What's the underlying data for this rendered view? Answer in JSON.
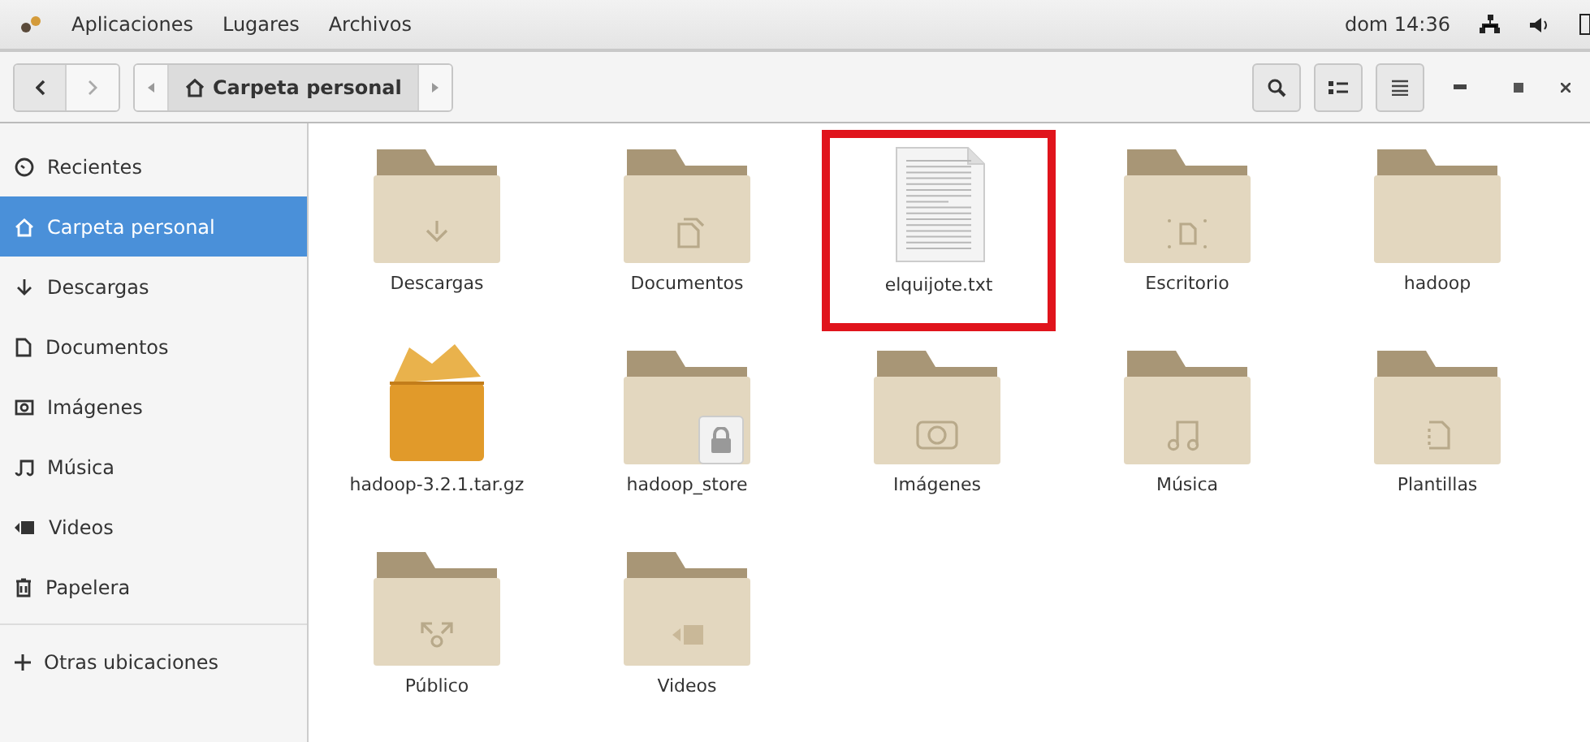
{
  "top_bar": {
    "menus": [
      "Aplicaciones",
      "Lugares",
      "Archivos"
    ],
    "clock": "dom 14:36"
  },
  "header": {
    "back_enabled": true,
    "forward_enabled": false,
    "path": [
      {
        "label": "Carpeta personal",
        "selected": true
      }
    ]
  },
  "sidebar": {
    "items": [
      {
        "label": "Recientes",
        "selected": false
      },
      {
        "label": "Carpeta personal",
        "selected": true
      },
      {
        "label": "Descargas",
        "selected": false
      },
      {
        "label": "Documentos",
        "selected": false
      },
      {
        "label": "Imágenes",
        "selected": false
      },
      {
        "label": "Música",
        "selected": false
      },
      {
        "label": "Videos",
        "selected": false
      },
      {
        "label": "Papelera",
        "selected": false
      }
    ],
    "other": {
      "label": "Otras ubicaciones"
    }
  },
  "files": [
    {
      "name": "Descargas",
      "kind": "folder",
      "highlighted": false
    },
    {
      "name": "Documentos",
      "kind": "folder",
      "highlighted": false
    },
    {
      "name": "elquijote.txt",
      "kind": "text",
      "highlighted": true
    },
    {
      "name": "Escritorio",
      "kind": "folder",
      "highlighted": false
    },
    {
      "name": "hadoop",
      "kind": "folder",
      "highlighted": false
    },
    {
      "name": "hadoop-3.2.1.tar.gz",
      "kind": "archive",
      "highlighted": false
    },
    {
      "name": "hadoop_store",
      "kind": "folder",
      "locked": true,
      "highlighted": false
    },
    {
      "name": "Imágenes",
      "kind": "folder",
      "highlighted": false
    },
    {
      "name": "Música",
      "kind": "folder",
      "highlighted": false
    },
    {
      "name": "Plantillas",
      "kind": "folder",
      "highlighted": false
    },
    {
      "name": "Público",
      "kind": "folder",
      "highlighted": false
    },
    {
      "name": "Videos",
      "kind": "folder",
      "highlighted": false
    }
  ]
}
